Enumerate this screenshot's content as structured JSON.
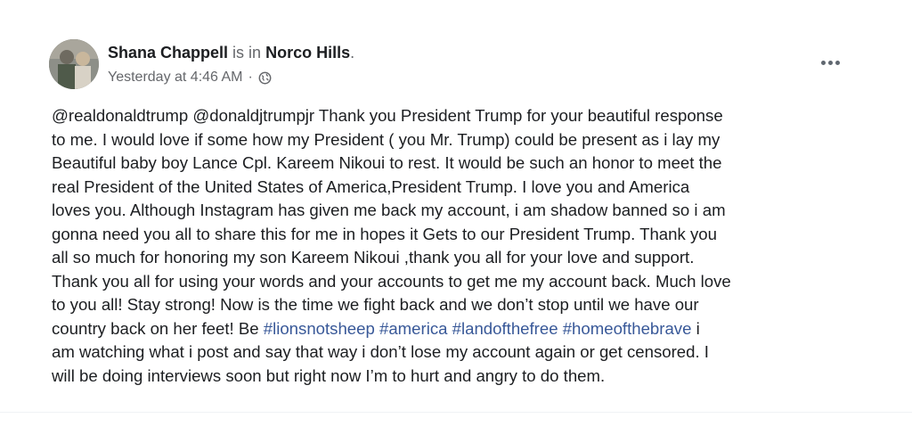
{
  "author": {
    "name": "Shana Chappell",
    "is_in": "is in",
    "location": "Norco Hills",
    "period": "."
  },
  "meta": {
    "timestamp": "Yesterday at 4:46 AM",
    "separator": "·",
    "privacy_icon": "globe-icon"
  },
  "more_icon": "ellipsis-icon",
  "post": {
    "lines": [
      "@realdonaldtrump @donaldjtrumpjr  Thank you President Trump for your beautiful response",
      "to me. I would love if some how my President ( you Mr. Trump) could be present as i lay my",
      "Beautiful baby boy Lance Cpl. Kareem Nikoui to rest. It would be such an honor to meet the",
      "real President of the United States of America,President Trump.  I love you and America",
      "loves you. Although Instagram has given me back my account, i am shadow banned so i am",
      "gonna need you all to share this for me in hopes it Gets to our President Trump. Thank you",
      "all so much for honoring my son Kareem Nikoui ,thank you all for your love and support.",
      "Thank you all for using your words and your accounts to get me my account back. Much love",
      "to you all! Stay strong! Now is the time we fight back and we don’t stop until we have our"
    ],
    "line10_prefix": "country back on her feet! Be ",
    "hashtags": [
      "#lionsnotsheep",
      "#america",
      "#landofthefree",
      "#homeofthebrave"
    ],
    "line10_suffix": " i",
    "closing_lines": [
      "am watching what i post and say that way i don’t lose my account again or get censored. I",
      "will be doing interviews soon but right now I’m to hurt and angry to do them."
    ]
  },
  "colors": {
    "hashtag": "#385898",
    "secondary_text": "#65676b",
    "primary_text": "#1c1e21"
  }
}
